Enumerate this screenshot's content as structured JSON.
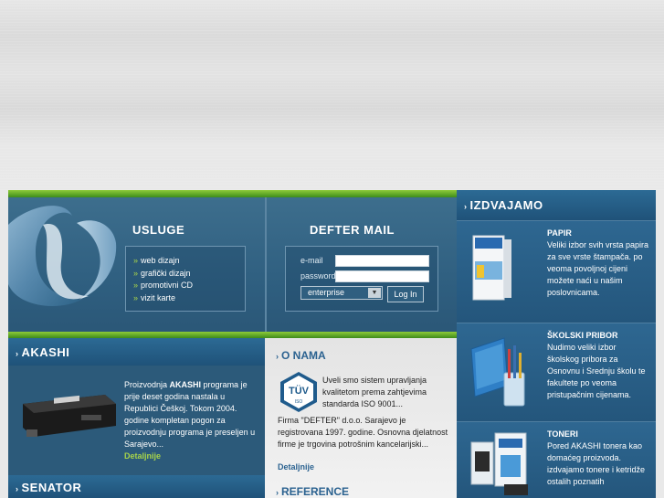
{
  "usluge": {
    "title": "USLUGE",
    "items": [
      {
        "label": "web dizajn"
      },
      {
        "label": "grafički dizajn"
      },
      {
        "label": "promotivni CD"
      },
      {
        "label": "vizit karte"
      }
    ]
  },
  "mail": {
    "title": "DEFTER MAIL",
    "email_label": "e-mail",
    "password_label": "password",
    "email_value": "",
    "password_value": "",
    "domain_select": "enterprise",
    "login_label": "Log In"
  },
  "izdvajamo": {
    "title": "IZDVAJAMO",
    "sections": [
      {
        "heading": "PAPIR",
        "text": "Veliki izbor svih vrsta papira za sve vrste štampača. po veoma povoljnoj cijeni možete naći u našim poslovnicama."
      },
      {
        "heading": "ŠKOLSKI PRIBOR",
        "text": "Nudimo veliki izbor školskog pribora za Osnovnu i Srednju školu te fakultete po veoma pristupačnim cijenama."
      },
      {
        "heading": "TONERI",
        "text": "Pored AKASHI tonera kao domaćeg proizvoda. izdvajamo tonere i ketridže ostalih poznatih"
      }
    ]
  },
  "akashi": {
    "title": "AKASHI",
    "text_before": "Proizvodnja ",
    "text_bold": "AKASHI",
    "text_after": " programa je prije deset godina nastala u Republici Češkoj. Tokom 2004. godine kompletan pogon za proizvodnju programa je preseljen u Sarajevo...",
    "more": "Detaljnije"
  },
  "senator": {
    "title": "SENATOR"
  },
  "onama": {
    "title": "O NAMA",
    "badge_text": "TÜV",
    "badge_sub": "ISO",
    "text1": "Uveli smo sistem upravljanja kvalitetom prema zahtjevima standarda ISO 9001...",
    "text2": "Firma \"DEFTER\" d.o.o. Sarajevo je registrovana 1997. godine. Osnovna djelatnost firme je trgovina potrošnim kancelarijski...",
    "more": "Detaljnije"
  },
  "reference": {
    "title": "REFERENCE"
  }
}
